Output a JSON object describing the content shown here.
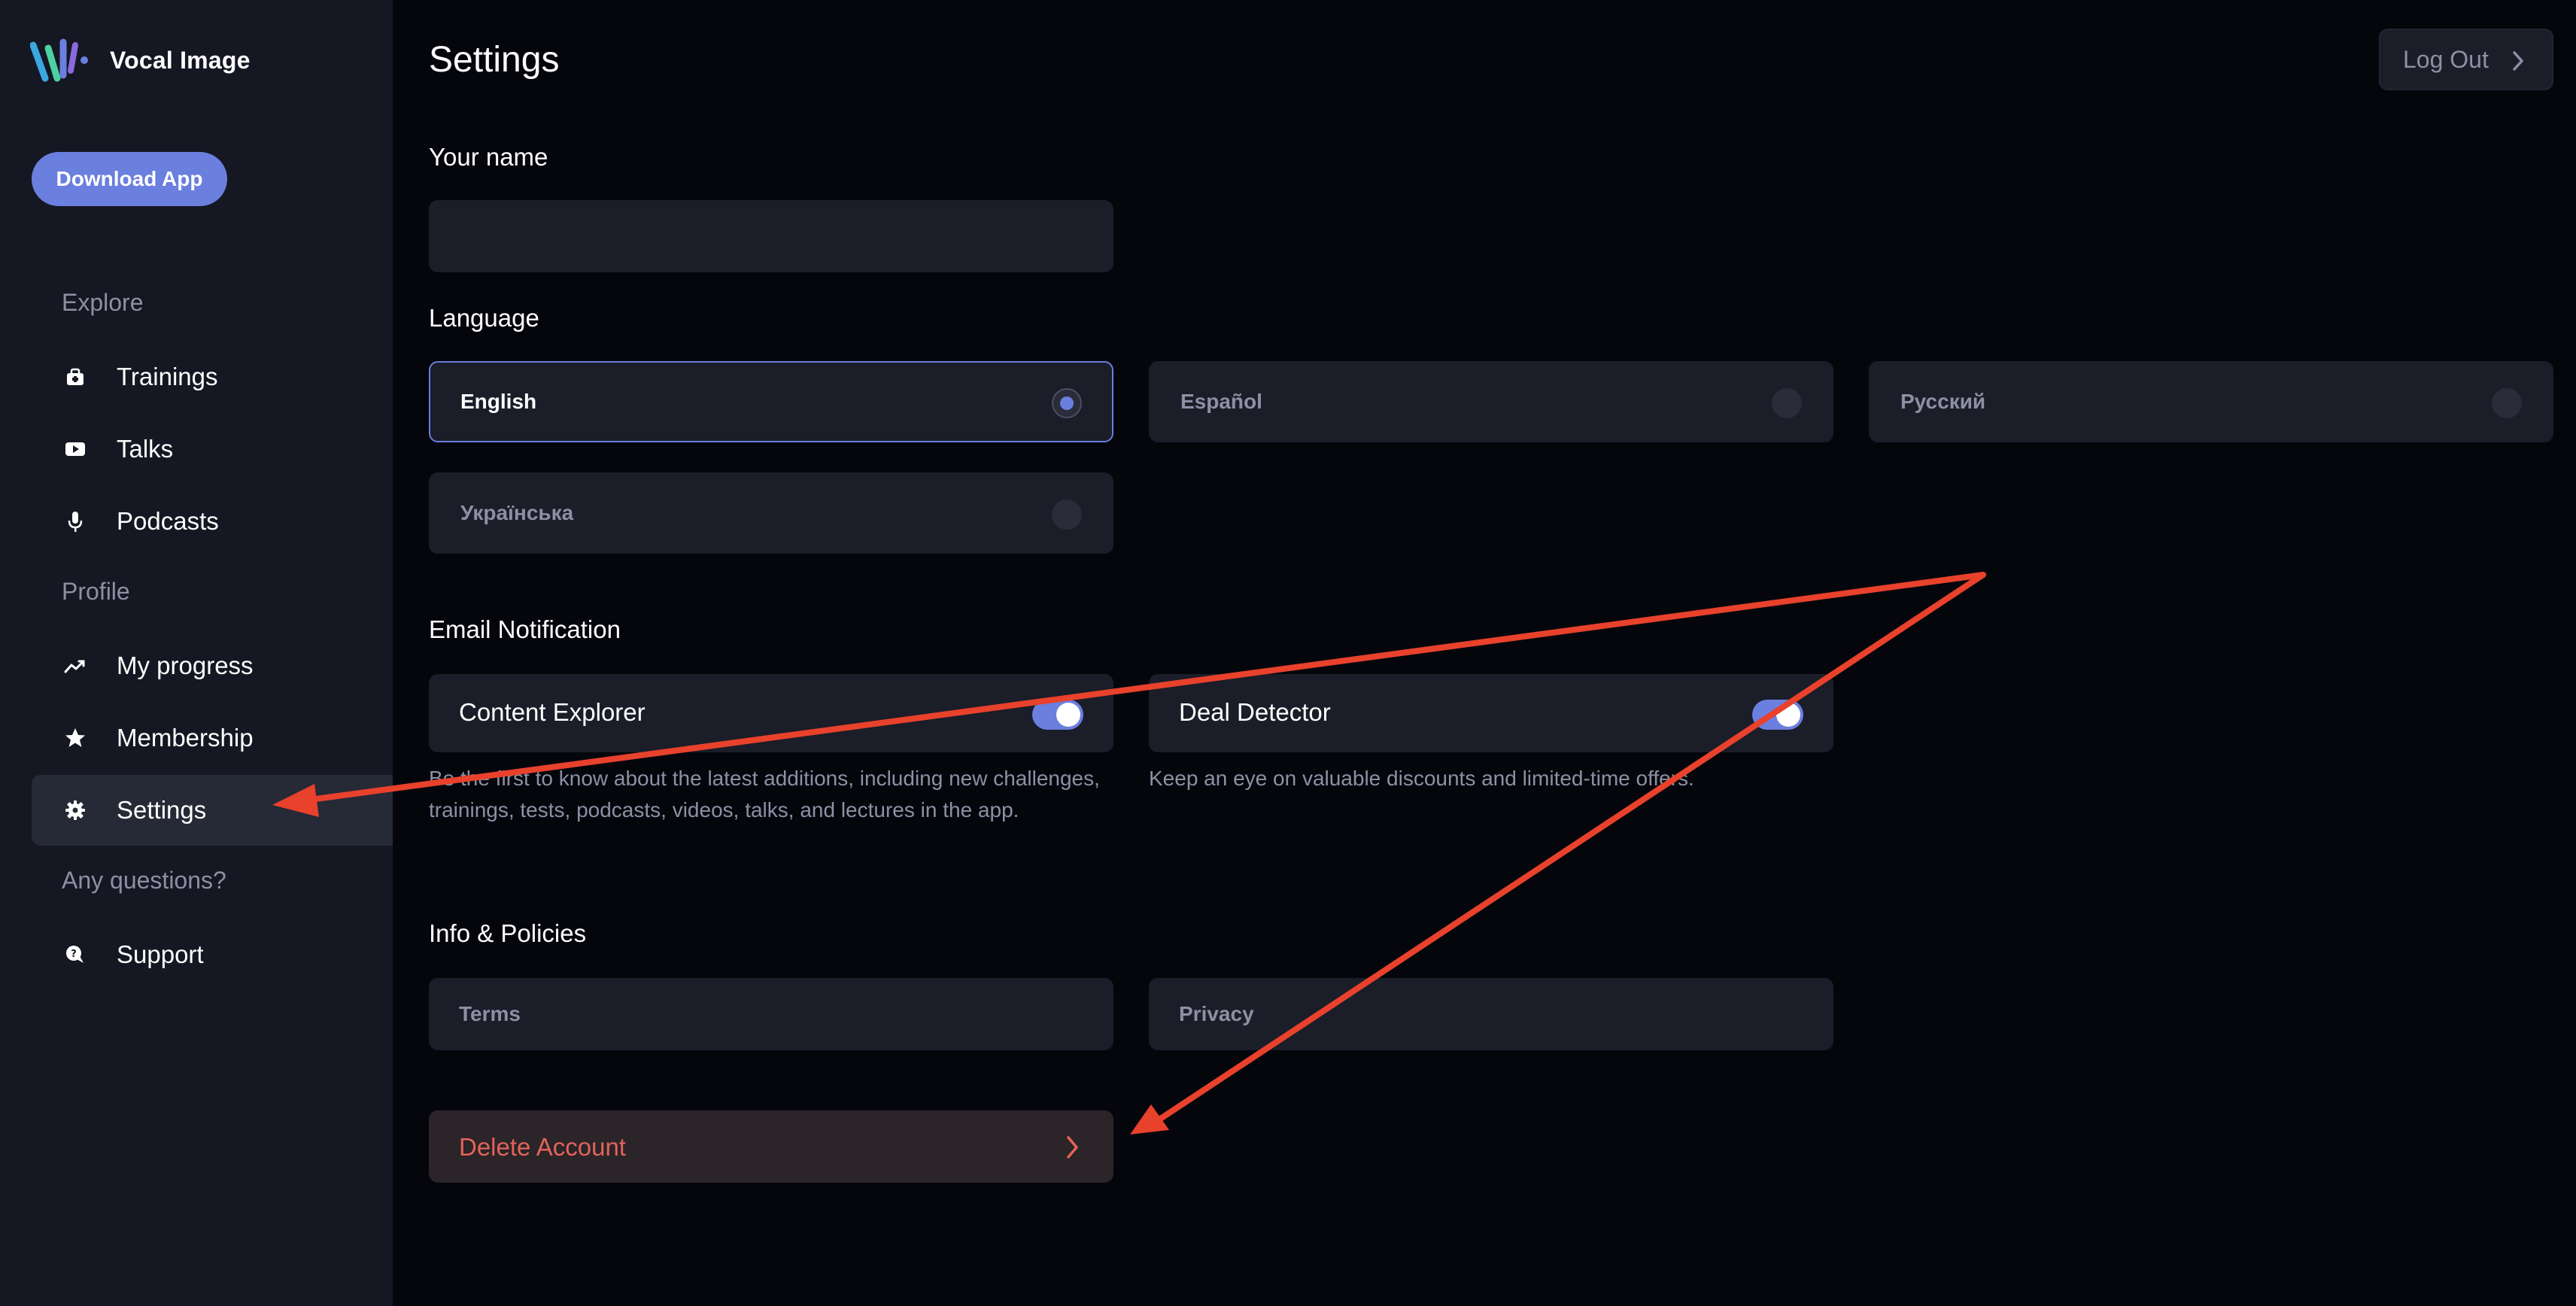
{
  "app": {
    "name": "Vocal Image"
  },
  "sidebar": {
    "download_label": "Download App",
    "sections": [
      {
        "label": "Explore"
      },
      {
        "label": "Profile"
      },
      {
        "label": "Any questions?"
      }
    ],
    "items": [
      {
        "label": "Trainings",
        "icon": "trainings-icon"
      },
      {
        "label": "Talks",
        "icon": "play-icon"
      },
      {
        "label": "Podcasts",
        "icon": "microphone-icon"
      },
      {
        "label": "My progress",
        "icon": "trend-line-icon"
      },
      {
        "label": "Membership",
        "icon": "star-icon"
      },
      {
        "label": "Settings",
        "icon": "gear-icon",
        "active": true
      },
      {
        "label": "Support",
        "icon": "support-icon"
      }
    ]
  },
  "header": {
    "title": "Settings",
    "logout_label": "Log Out"
  },
  "name_field": {
    "label": "Your name",
    "value": "",
    "placeholder": ""
  },
  "language": {
    "label": "Language",
    "options": [
      {
        "label": "English",
        "selected": true
      },
      {
        "label": "Español",
        "selected": false
      },
      {
        "label": "Русский",
        "selected": false
      },
      {
        "label": "Українська",
        "selected": false
      }
    ]
  },
  "notifications": {
    "label": "Email Notification",
    "items": [
      {
        "label": "Content Explorer",
        "enabled": true,
        "description": "Be the first to know about the latest additions, including new challenges, trainings, tests, podcasts, videos, talks, and lectures in the app."
      },
      {
        "label": "Deal Detector",
        "enabled": true,
        "description": "Keep an eye on valuable discounts and limited-time offers."
      }
    ]
  },
  "policies": {
    "label": "Info & Policies",
    "items": [
      {
        "label": "Terms"
      },
      {
        "label": "Privacy"
      }
    ]
  },
  "delete_account": {
    "label": "Delete Account"
  },
  "colors": {
    "background": "#05060c",
    "sidebar": "#151722",
    "card": "#1b1d28",
    "accent": "#6a7fde",
    "danger": "#e0645a",
    "annotation": "#e8412c",
    "muted_text": "#8d90a5"
  }
}
